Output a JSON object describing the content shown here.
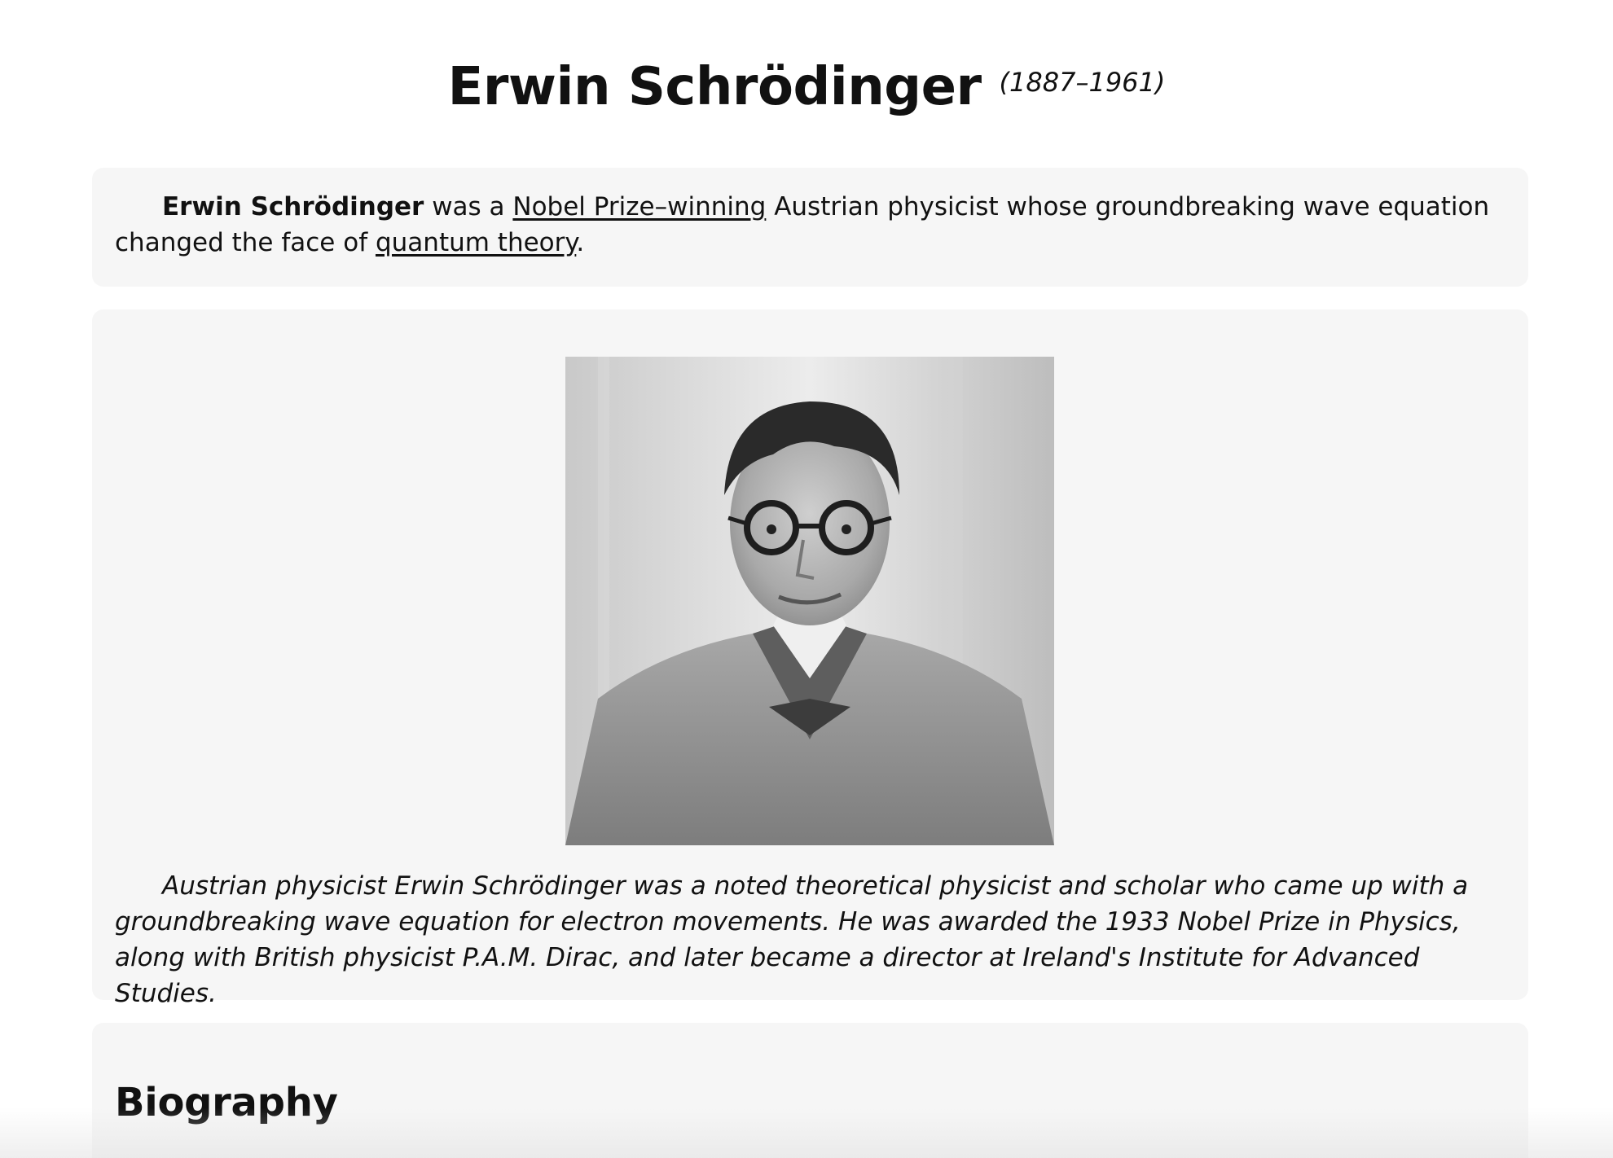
{
  "header": {
    "title": "Erwin Schrödinger",
    "dates": "(1887–1961)"
  },
  "intro": {
    "name": "Erwin Schrödinger",
    "text_1": " was a ",
    "link_1": "Nobel Prize–winning",
    "text_2": " Austrian physicist whose groundbreaking wave equation changed the face of ",
    "link_2": "quantum theory",
    "text_3": "."
  },
  "photo": {
    "caption": "Austrian physicist Erwin Schrödinger was a noted theoretical physicist and scholar who came up with a groundbreaking wave equation for electron movements. He was awarded the 1933 Nobel Prize in Physics, along with British physicist P.A.M. Dirac, and later became a director at Ireland's Institute for Advanced Studies."
  },
  "biography": {
    "heading": "Biography"
  }
}
